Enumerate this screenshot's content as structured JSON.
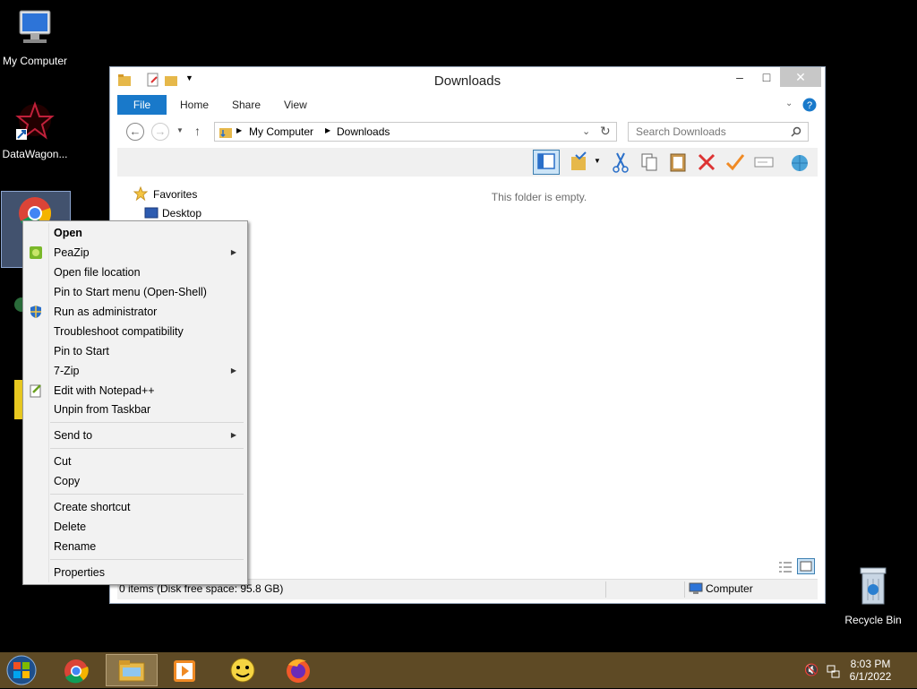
{
  "desktop": {
    "icons": [
      {
        "label": "My Computer"
      },
      {
        "label": "DataWagon..."
      },
      {
        "label": "Recycle Bin"
      }
    ]
  },
  "window": {
    "title": "Downloads",
    "controls": {
      "minimize": "–",
      "maximize": "□",
      "close": "✕"
    },
    "ribbon_tabs": [
      "File",
      "Home",
      "Share",
      "View"
    ],
    "address": {
      "parts": [
        "My Computer",
        "Downloads"
      ]
    },
    "search_placeholder": "Search Downloads",
    "nav": {
      "favorites": "Favorites",
      "desktop": "Desktop"
    },
    "empty_message": "This folder is empty.",
    "status": {
      "items": "0 items (Disk free space: 95.8 GB)",
      "location": "Computer"
    }
  },
  "context_menu": {
    "items": [
      {
        "label": "Open",
        "bold": true
      },
      {
        "label": "PeaZip",
        "submenu": true
      },
      {
        "label": "Open file location"
      },
      {
        "label": "Pin to Start menu (Open-Shell)"
      },
      {
        "label": "Run as administrator"
      },
      {
        "label": "Troubleshoot compatibility"
      },
      {
        "label": "Pin to Start"
      },
      {
        "label": "7-Zip",
        "submenu": true
      },
      {
        "label": "Edit with Notepad++"
      },
      {
        "label": "Unpin from Taskbar"
      },
      {
        "label": "Send to",
        "submenu": true
      },
      {
        "label": "Cut"
      },
      {
        "label": "Copy"
      },
      {
        "label": "Create shortcut"
      },
      {
        "label": "Delete"
      },
      {
        "label": "Rename"
      },
      {
        "label": "Properties"
      }
    ]
  },
  "taskbar": {
    "time": "8:03 PM",
    "date": "6/1/2022"
  },
  "colors": {
    "ribbon_file": "#1979ca",
    "taskbar": "#5e4a25",
    "desktop": "#000000"
  }
}
